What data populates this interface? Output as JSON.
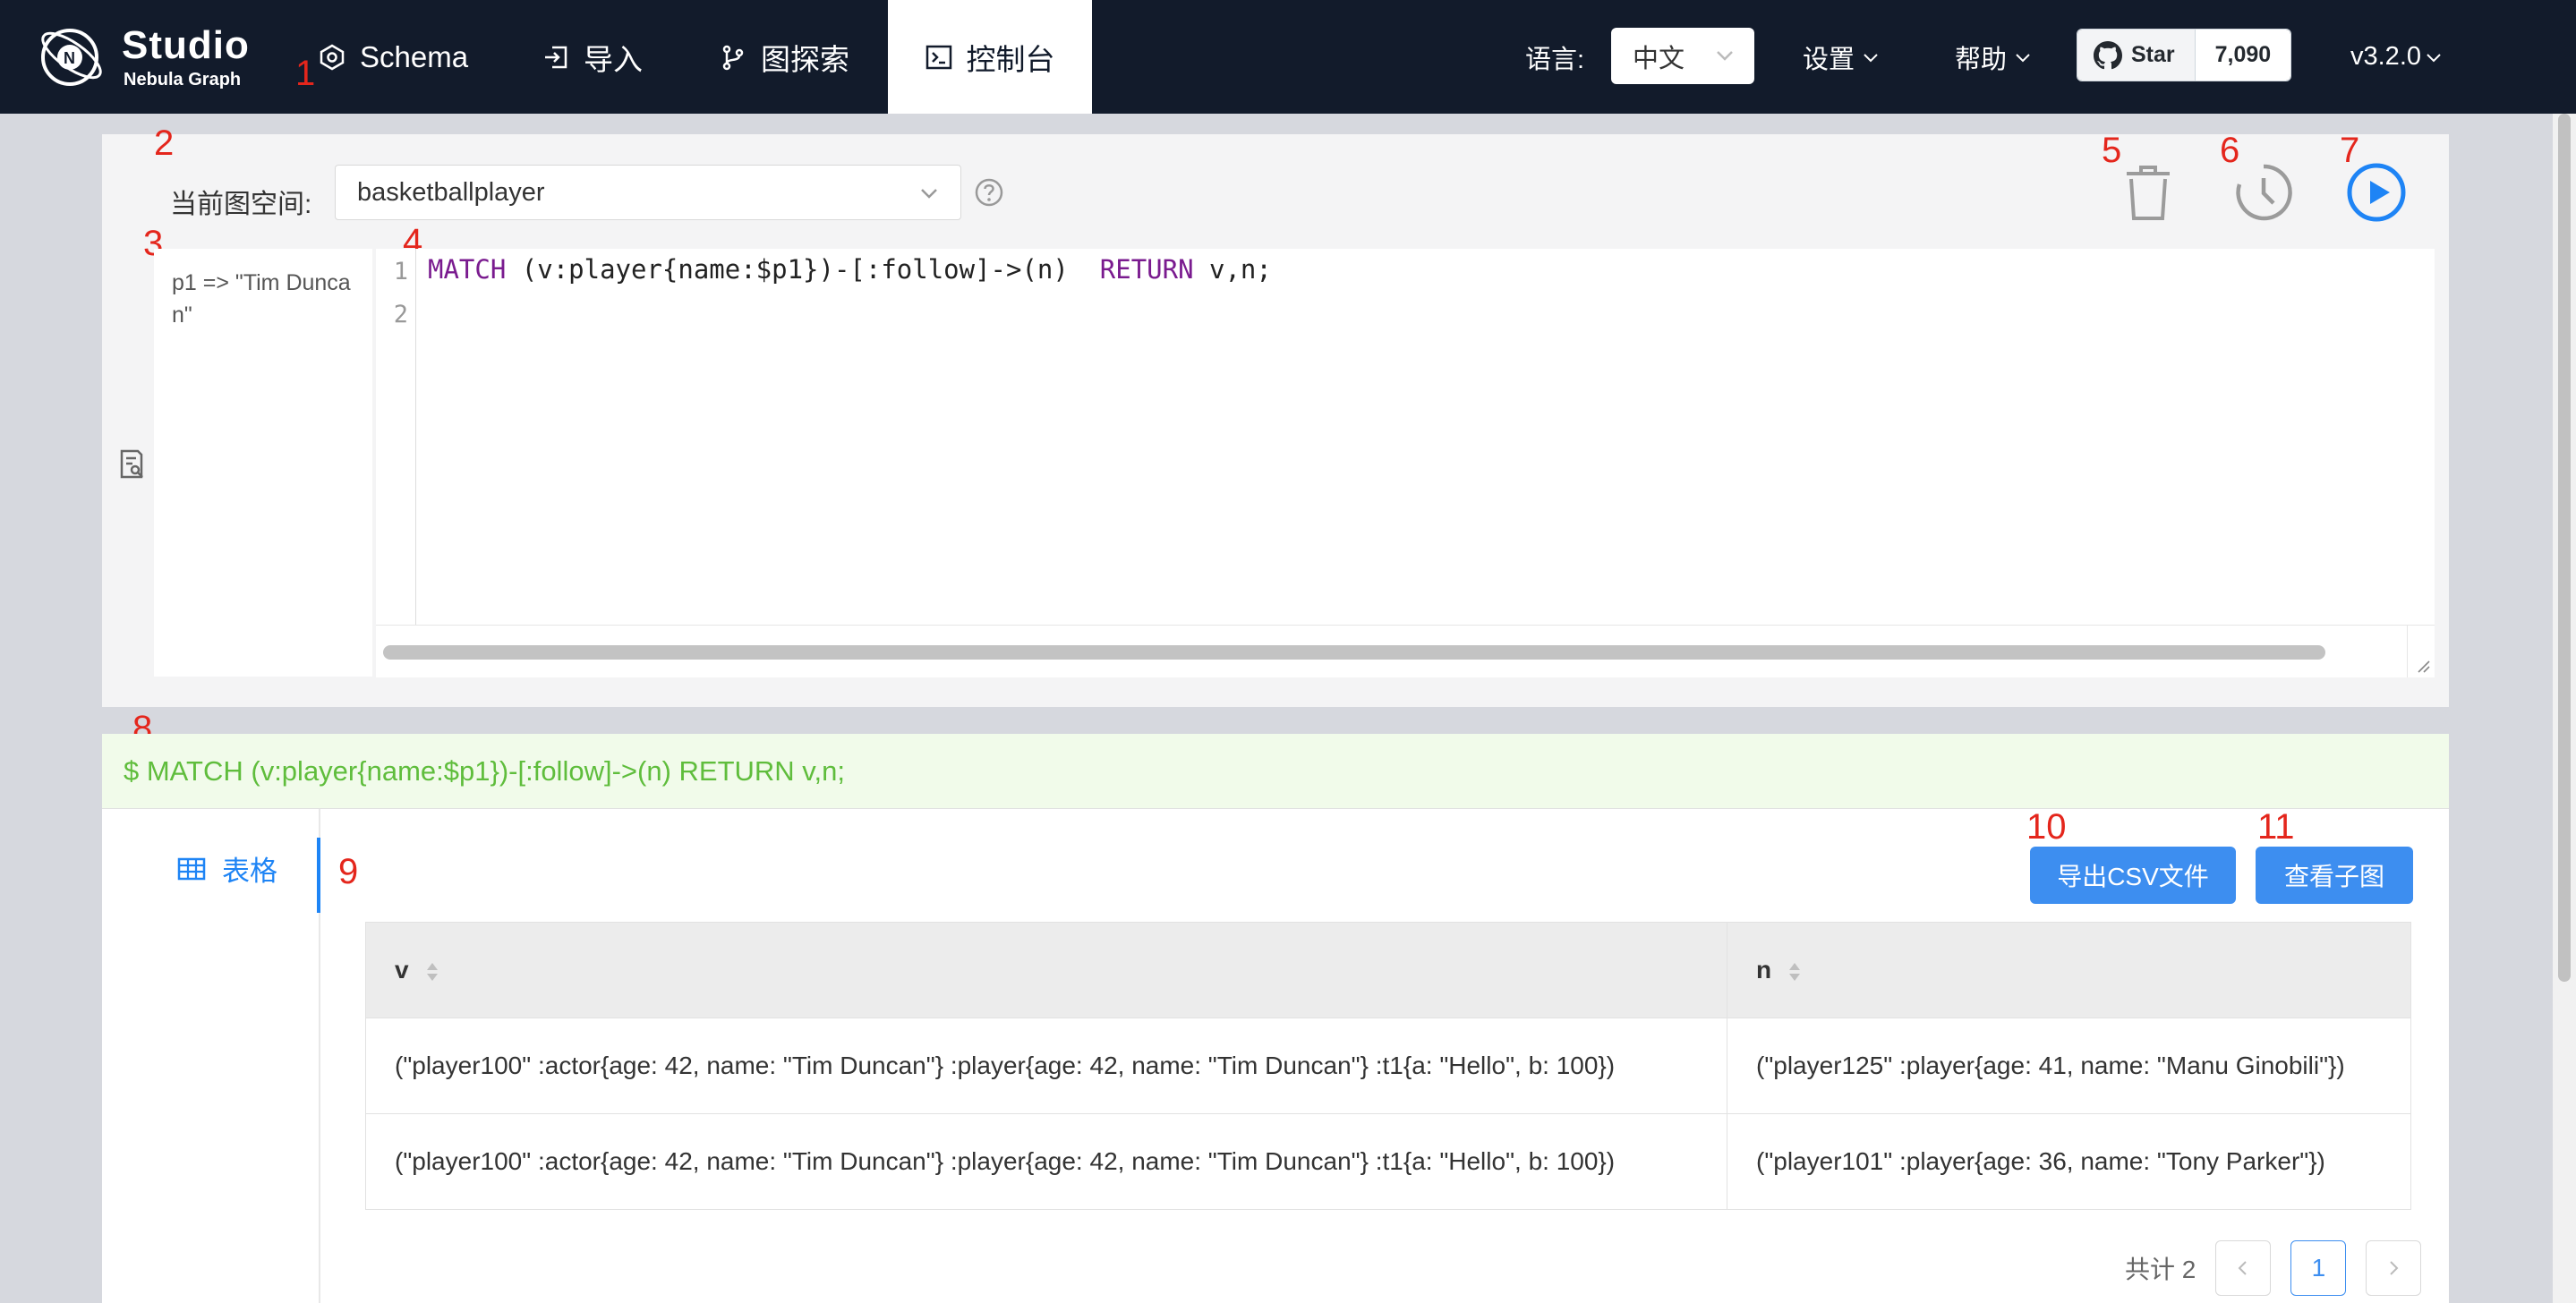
{
  "brand": {
    "title": "Studio",
    "subtitle": "Nebula Graph"
  },
  "nav": {
    "items": [
      {
        "label": "Schema",
        "icon": "hexagon-icon"
      },
      {
        "label": "导入",
        "icon": "import-icon"
      },
      {
        "label": "图探索",
        "icon": "branch-icon"
      },
      {
        "label": "控制台",
        "icon": "terminal-icon",
        "active": true
      }
    ]
  },
  "header": {
    "language_label": "语言:",
    "language_value": "中文",
    "settings_label": "设置",
    "help_label": "帮助",
    "github_star_label": "Star",
    "github_star_count": "7,090",
    "version_label": "v3.2.0"
  },
  "annotations": [
    "1",
    "2",
    "3",
    "4",
    "5",
    "6",
    "7",
    "8",
    "9",
    "10",
    "11"
  ],
  "console": {
    "space_label": "当前图空间:",
    "space_value": "basketballplayer",
    "params_text": "p1 => \"Tim Duncan\"",
    "line_numbers": [
      "1",
      "2"
    ],
    "code": {
      "kw1": "MATCH",
      "mid": " (v:player{name:$p1})-[:follow]->(n)  ",
      "kw2": "RETURN",
      "tail": " v,n;"
    }
  },
  "result": {
    "command": "$ MATCH (v:player{name:$p1})-[:follow]->(n) RETURN v,n;",
    "tab_label": "表格",
    "export_button": "导出CSV文件",
    "subgraph_button": "查看子图",
    "columns": [
      "v",
      "n"
    ],
    "rows": [
      [
        "(\"player100\" :actor{age: 42, name: \"Tim Duncan\"} :player{age: 42, name: \"Tim Duncan\"} :t1{a: \"Hello\", b: 100})",
        "(\"player125\" :player{age: 41, name: \"Manu Ginobili\"})"
      ],
      [
        "(\"player100\" :actor{age: 42, name: \"Tim Duncan\"} :player{age: 42, name: \"Tim Duncan\"} :t1{a: \"Hello\", b: 100})",
        "(\"player101\" :player{age: 36, name: \"Tony Parker\"})"
      ]
    ],
    "total_label": "共计 2",
    "current_page": "1"
  },
  "colors": {
    "header_bg": "#121b2b",
    "primary": "#3d8ef0",
    "command_text": "#5fbd3c",
    "keyword": "#7a1b8f",
    "annotation": "#e4261c"
  }
}
